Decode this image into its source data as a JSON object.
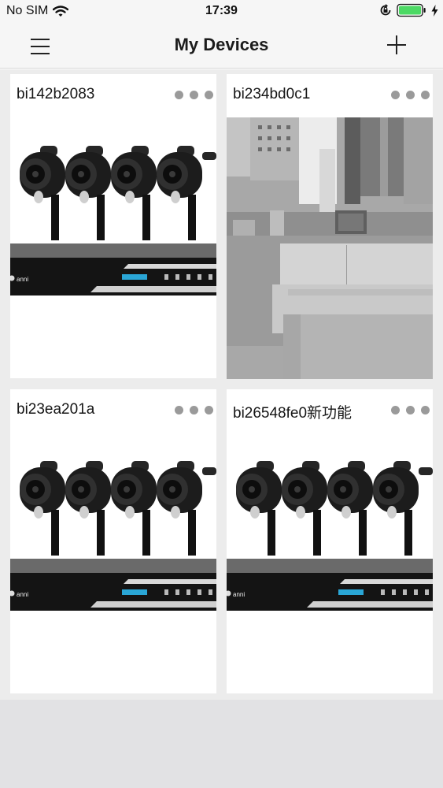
{
  "status_bar": {
    "carrier": "No SIM",
    "time": "17:39"
  },
  "nav": {
    "title": "My Devices",
    "menu_icon": "hamburger-menu-icon",
    "add_icon": "plus-icon"
  },
  "devices": [
    {
      "name": "bi142b2083",
      "thumbnail": "nvr-camera-kit-product"
    },
    {
      "name": "bi234bd0c1",
      "thumbnail": "night-vision-room-snapshot"
    },
    {
      "name": "bi23ea201a",
      "thumbnail": "nvr-camera-kit-product"
    },
    {
      "name": "bi26548fe0新功能",
      "thumbnail": "nvr-camera-kit-product"
    }
  ],
  "nvr_brand": "anni",
  "colors": {
    "nav_background": "#f6f6f6",
    "content_background": "#ececec",
    "card_background": "#ffffff",
    "more_dot": "#9a9a9a",
    "battery_fill": "#4cd964"
  }
}
